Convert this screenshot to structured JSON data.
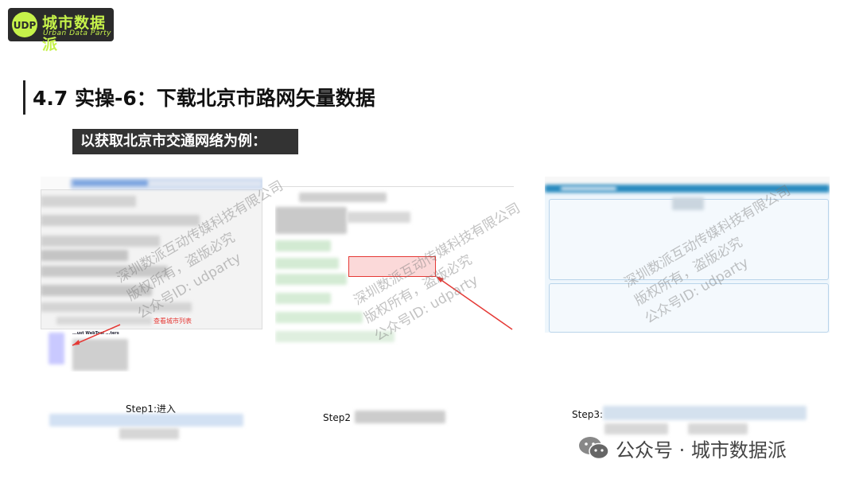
{
  "logo": {
    "name": "城市数据派",
    "sub": "Urban Data Party"
  },
  "title": "4.7 实操-6：下载北京市路网矢量数据",
  "subtitle": "以获取北京市交通网络为例：",
  "panels": [
    {
      "caption": "Step1:进入",
      "annotation": "查看城市列表",
      "mini_title": "...ust WebTool  ...ters"
    },
    {
      "caption": "Step2"
    },
    {
      "caption": "Step3:"
    }
  ],
  "watermark": {
    "line1": "深圳数派互动传媒科技有限公司",
    "line2": "版权所有，盗版必究",
    "line3": "公众号ID: udparty"
  },
  "footer": {
    "text": "公众号 · 城市数据派"
  },
  "colors": {
    "logo_green": "#c6f24a",
    "arrow_red": "#e53935",
    "subtitle_bg": "#333333"
  }
}
